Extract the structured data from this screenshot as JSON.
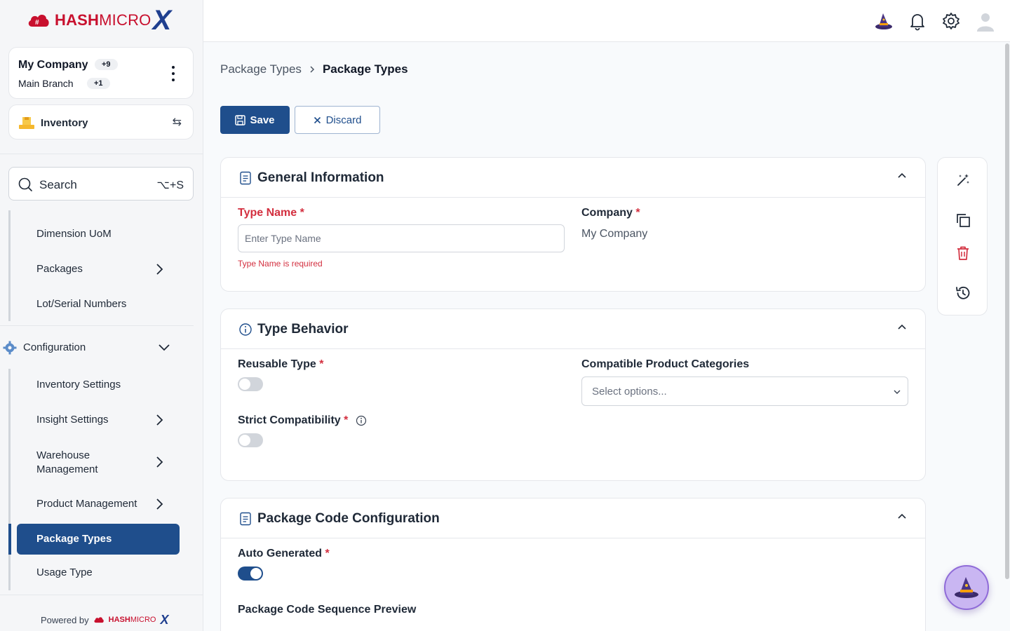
{
  "brand": {
    "name_bold": "HASH",
    "name_light": "MICRO",
    "mark": "X"
  },
  "company": {
    "name": "My Company",
    "name_badge": "+9",
    "branch": "Main Branch",
    "branch_badge": "+1"
  },
  "module": {
    "label": "Inventory",
    "icon": "inventory-icon"
  },
  "search": {
    "label": "Search",
    "shortcut": "⌥+S"
  },
  "nav": {
    "items_top": [
      {
        "label": "Dimension UoM"
      },
      {
        "label": "Packages"
      },
      {
        "label": "Lot/Serial Numbers"
      }
    ],
    "configuration": {
      "label": "Configuration"
    },
    "config_items": [
      {
        "label": "Inventory Settings"
      },
      {
        "label": "Insight Settings"
      },
      {
        "label": "Warehouse Management"
      },
      {
        "label": "Product Management"
      },
      {
        "label": "Package Types"
      },
      {
        "label": "Usage Type"
      }
    ],
    "active": "Package Types"
  },
  "footer": {
    "powered_by": "Powered by"
  },
  "topbar": {
    "icons": [
      "wizard-hat-icon",
      "bell-icon",
      "gear-icon",
      "avatar"
    ]
  },
  "breadcrumb": {
    "parent": "Package Types",
    "current": "Package Types"
  },
  "actions": {
    "save": "Save",
    "discard": "Discard"
  },
  "sections": {
    "general": {
      "title": "General Information",
      "type_name_label": "Type Name",
      "type_name_placeholder": "Enter Type Name",
      "type_name_value": "",
      "type_name_error": "Type Name is required",
      "company_label": "Company",
      "company_value": "My Company"
    },
    "behavior": {
      "title": "Type Behavior",
      "reusable_label": "Reusable Type",
      "reusable_on": false,
      "categories_label": "Compatible Product Categories",
      "categories_placeholder": "Select options...",
      "strict_label": "Strict Compatibility",
      "strict_on": false
    },
    "code": {
      "title": "Package Code Configuration",
      "auto_label": "Auto Generated",
      "auto_on": true,
      "preview_label": "Package Code Sequence Preview"
    }
  },
  "required_mark": "*",
  "colors": {
    "primary": "#1f4e8c",
    "error": "#d32f3f",
    "brand_red": "#c8102e"
  }
}
